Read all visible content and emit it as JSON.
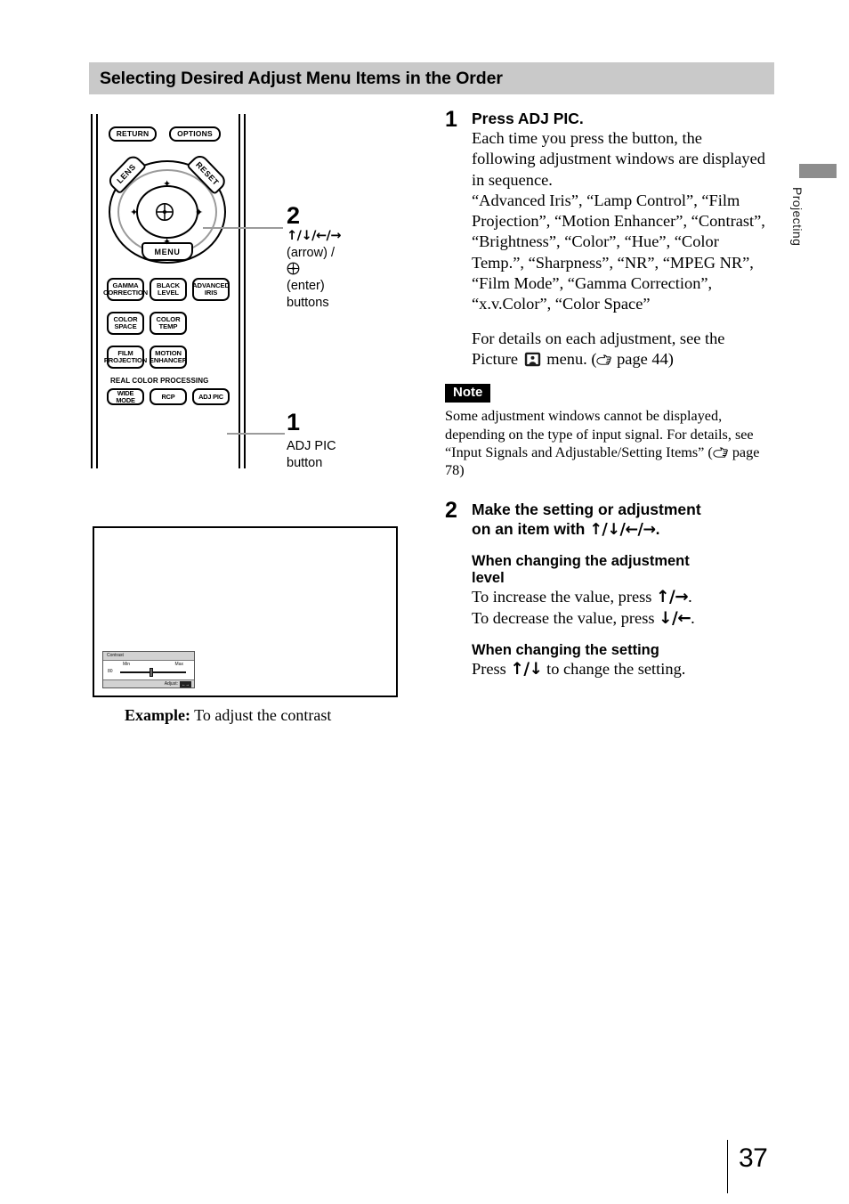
{
  "page": {
    "section_title": "Selecting Desired Adjust Menu Items in the Order",
    "side_tab": "Projecting",
    "page_number": "37"
  },
  "remote": {
    "top_buttons": [
      {
        "label": "RETURN"
      },
      {
        "label": "OPTIONS"
      }
    ],
    "dpad": {
      "lens": "LENS",
      "reset": "RESET",
      "menu": "MENU",
      "up_arrow": "✦",
      "down_arrow": "✦",
      "left_arrow": "✦",
      "right_arrow": "✦"
    },
    "grid_buttons": [
      {
        "line1": "GAMMA",
        "line2": "CORRECTION"
      },
      {
        "line1": "BLACK",
        "line2": "LEVEL"
      },
      {
        "line1": "ADVANCED",
        "line2": "IRIS"
      },
      {
        "line1": "COLOR",
        "line2": "SPACE"
      },
      {
        "line1": "COLOR",
        "line2": "TEMP"
      },
      {
        "line1": "FILM",
        "line2": "PROJECTION"
      },
      {
        "line1": "MOTION",
        "line2": "ENHANCER"
      }
    ],
    "rcp_title": "REAL COLOR PROCESSING",
    "rcp_buttons": [
      {
        "label": "WIDE MODE"
      },
      {
        "label": "RCP"
      },
      {
        "label": "ADJ PIC"
      }
    ]
  },
  "callouts": {
    "two": {
      "number": "2",
      "arrows": "↑/↓/←/→",
      "line2": "(arrow) / ",
      "line3": "(enter) buttons"
    },
    "one": {
      "number": "1",
      "line1": "ADJ PIC",
      "line2": "button"
    }
  },
  "example": {
    "caption_label": "Example:",
    "caption_text": " To adjust the contrast",
    "osd": {
      "title": "Contrast",
      "min": "Min",
      "max": "Max",
      "value": "80",
      "footer_label": "Adjust:",
      "footer_keys": "←→"
    }
  },
  "steps": [
    {
      "number": "1",
      "title": "Press ADJ PIC.",
      "paragraph1": "Each time you press the button, the following adjustment windows are displayed in sequence.",
      "paragraph2": "“Advanced Iris”, “Lamp Control”, “Film Projection”, “Motion Enhancer”, “Contrast”, “Brightness”, “Color”, “Hue”, “Color Temp.”, “Sharpness”, “NR”, “MPEG NR”, “Film Mode”, “Gamma Correction”, “x.v.Color”, “Color Space”",
      "details_pre": "For details on each adjustment, see the Picture ",
      "details_post": " menu. (",
      "details_page": " page 44)"
    },
    {
      "number": "2",
      "title_line1": "Make the setting or adjustment",
      "title_line2_pre": "on an item with ",
      "title_line2_arrows": "↑/↓/←/→",
      "title_line2_post": ".",
      "sub1_line1": "When changing the adjustment",
      "sub1_line2": "level",
      "sub1_text1_pre": "To increase the value, press ",
      "sub1_text1_arrows": "↑/→",
      "sub1_text1_post": ".",
      "sub1_text2_pre": "To decrease the value, press ",
      "sub1_text2_arrows": "↓/←",
      "sub1_text2_post": ".",
      "sub2_head": "When changing the setting",
      "sub2_text_pre": "Press ",
      "sub2_text_arrows": "↑/↓",
      "sub2_text_post": " to change the setting."
    }
  ],
  "note": {
    "badge": "Note",
    "text_pre": "Some adjustment windows cannot be displayed, depending on the type of input signal. For details, see “Input Signals and Adjustable/Setting Items” (",
    "text_page": " page 78)"
  },
  "icons": {
    "picture_menu_icon": "picture-menu-icon",
    "page_ref_icon": "pointing-hand-icon",
    "enter_button_icon": "enter-crosshair-icon"
  }
}
